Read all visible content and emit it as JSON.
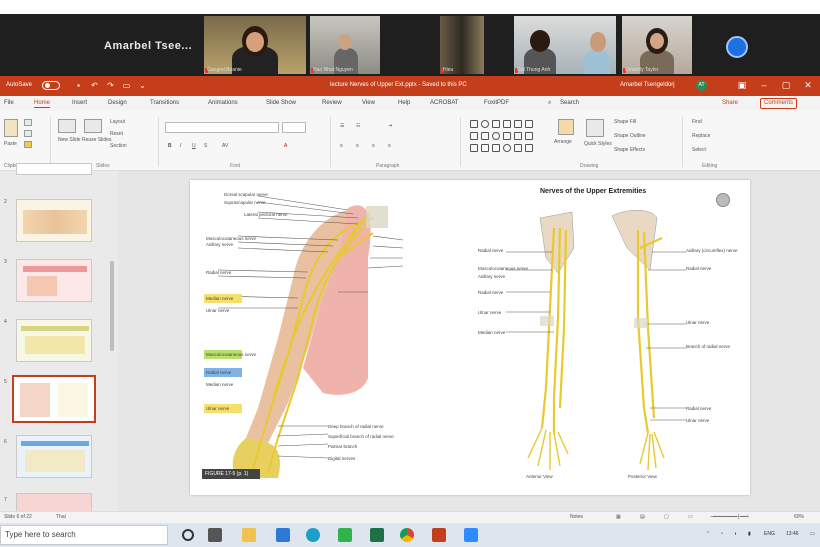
{
  "meeting": {
    "presenter_name": "Amarbel Tsee...",
    "participants": [
      {
        "name": "Gangrel Beanie"
      },
      {
        "name": "Hao Nhat Nguyen"
      },
      {
        "name": "Hieu"
      },
      {
        "name": "Gal Thung Anh"
      },
      {
        "name": "Umarbly Taylor"
      }
    ]
  },
  "titlebar": {
    "autosave_label": "AutoSave",
    "document_title": "lecture Nerves of Upper Ext.pptx - Saved to this PC",
    "user_name": "Amarbel Tsengeldorj"
  },
  "ribbon": {
    "tabs": [
      "File",
      "Home",
      "Insert",
      "Design",
      "Transitions",
      "Animations",
      "Slide Show",
      "Review",
      "View",
      "Help",
      "ACROBAT",
      "FoxitPDF",
      "Search"
    ],
    "active_tab": "Home",
    "share_label": "Share",
    "comments_label": "Comments",
    "groups": [
      "Clipboard",
      "Slides",
      "Font",
      "Paragraph",
      "Drawing",
      "Editing"
    ],
    "buttons": {
      "paste": "Paste",
      "new_slide": "New Slide",
      "reuse_slides": "Reuse Slides",
      "layout": "Layout",
      "reset": "Reset",
      "section": "Section",
      "arrange": "Arrange",
      "quick_styles": "Quick Styles",
      "shape_fill": "Shape Fill",
      "shape_outline": "Shape Outline",
      "shape_effects": "Shape Effects",
      "find": "Find",
      "replace": "Replace",
      "select": "Select"
    }
  },
  "slide": {
    "title": "Nerves of the Upper Extremities",
    "figure_tag": "FIGURE 17-5 (p. 1)",
    "left_labels": [
      "Dorsal scapular nerve",
      "Suprascapular nerve",
      "Lateral pectoral nerve",
      "Musculocutaneous nerve",
      "Axillary nerve",
      "Radial nerve",
      "Median nerve",
      "Ulnar nerve",
      "Musculocutaneous nerve",
      "Radial nerve",
      "Median nerve",
      "Ulnar nerve",
      "Deep branch of radial nerve",
      "Superficial branch of radial nerve",
      "Palmar branch",
      "Digital nerves"
    ],
    "right_labels": [
      "Radial nerve",
      "Musculocutaneous nerve",
      "Axillary nerve",
      "Radial nerve",
      "Ulnar nerve",
      "Median nerve",
      "Axillary (circumflex) nerve",
      "Radial nerve",
      "Ulnar nerve",
      "Branch of radial nerve",
      "Radial nerve",
      "Ulnar nerve"
    ],
    "anterior_caption": "Anterior View",
    "posterior_caption": "Posterior View"
  },
  "status": {
    "slide_info": "Slide 6 of 22",
    "language": "Thai",
    "notes": "Notes",
    "zoom": "60%"
  },
  "taskbar": {
    "search_placeholder": "Type here to search",
    "time": "13:46",
    "language": "ENG"
  },
  "colors": {
    "accent": "#c43e1c",
    "nerve": "#e8d23a",
    "skin": "#f0b3ab",
    "bone": "#e8d8c4"
  }
}
